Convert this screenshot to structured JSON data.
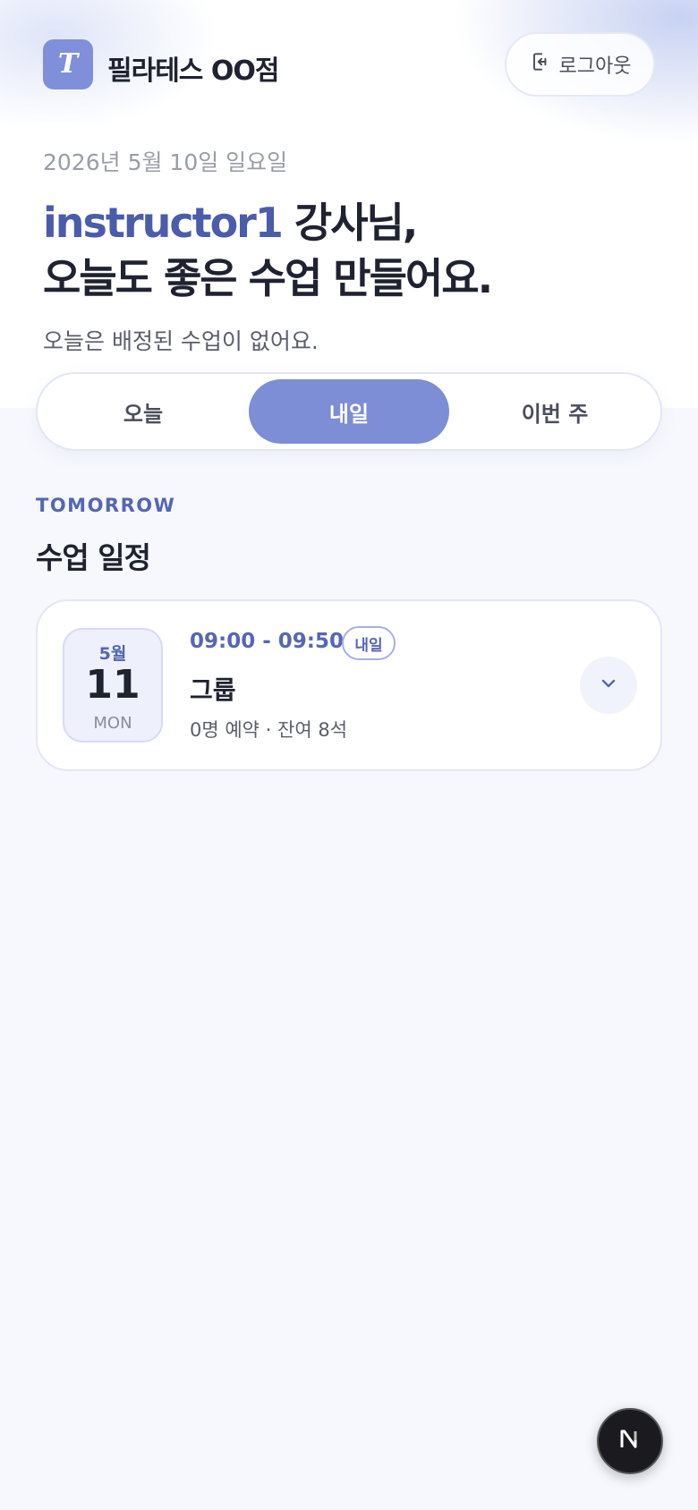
{
  "header": {
    "brand_initial": "T",
    "brand_name": "필라테스 OO점",
    "logout_label": "로그아웃"
  },
  "greeting": {
    "date": "2026년 5월 10일 일요일",
    "username": "instructor1",
    "title_suffix": " 강사님,",
    "title_line2": "오늘도 좋은 수업 만들어요.",
    "subtitle": "오늘은 배정된 수업이 없어요."
  },
  "tabs": [
    {
      "label": "오늘",
      "active": false
    },
    {
      "label": "내일",
      "active": true
    },
    {
      "label": "이번 주",
      "active": false
    }
  ],
  "section": {
    "eyebrow": "TOMORROW",
    "title": "수업 일정"
  },
  "classes": [
    {
      "month": "5월",
      "day": "11",
      "weekday": "MON",
      "time": "09:00 - 09:50",
      "badge": "내일",
      "name": "그룹",
      "meta": "0명 예약 · 잔여 8석"
    }
  ],
  "fab": {
    "icon": "nextjs-logo-icon"
  },
  "colors": {
    "accent": "#7d8dd6",
    "accent_text": "#5466b4",
    "username": "#4a5caa",
    "background": "#f7f8fe"
  }
}
